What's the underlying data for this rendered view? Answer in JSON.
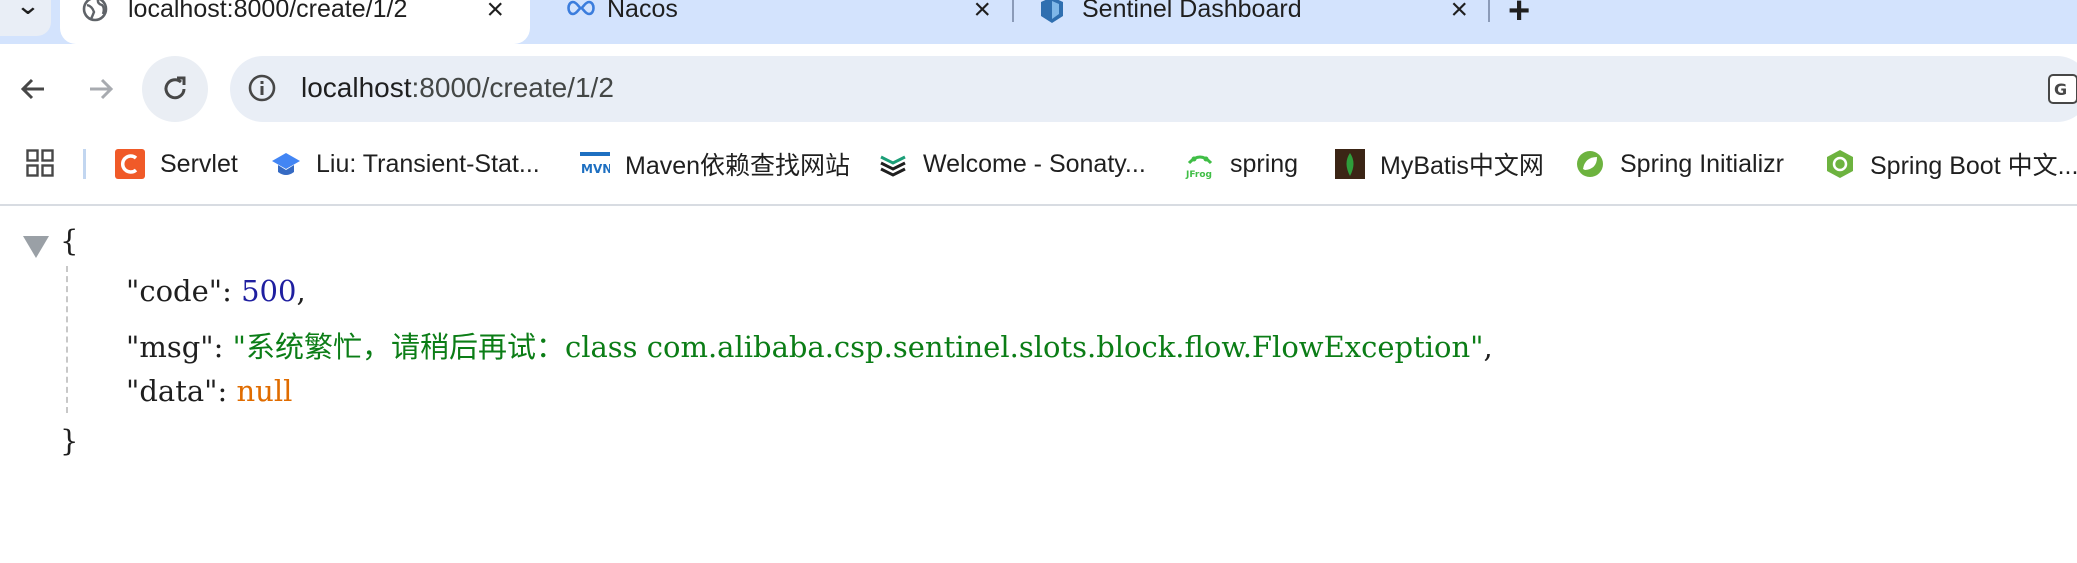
{
  "tabs": [
    {
      "title": "localhost:8000/create/1/2",
      "icon": "globe-icon",
      "active": true
    },
    {
      "title": "Nacos",
      "icon": "nacos-logo-icon",
      "active": false
    },
    {
      "title": "Sentinel Dashboard",
      "icon": "sentinel-logo-icon",
      "active": false
    }
  ],
  "address_bar": {
    "host": "localhost",
    "path": ":8000/create/1/2"
  },
  "bookmarks": [
    {
      "label": "Servlet",
      "icon": "servlet-icon"
    },
    {
      "label": "Liu: Transient-Stat...",
      "icon": "graduation-cap-icon"
    },
    {
      "label": "Maven依赖查找网站",
      "icon": "mvn-icon"
    },
    {
      "label": "Welcome - Sonaty...",
      "icon": "sonatype-icon"
    },
    {
      "label": "spring",
      "icon": "jfrog-icon"
    },
    {
      "label": "MyBatis中文网",
      "icon": "mybatis-icon"
    },
    {
      "label": "Spring Initializr",
      "icon": "spring-icon"
    },
    {
      "label": "Spring Boot 中文...",
      "icon": "spring-boot-icon"
    }
  ],
  "json_view": {
    "open_brace": "{",
    "close_brace": "}",
    "fields": [
      {
        "key": "\"code\"",
        "sep": ": ",
        "value": "500",
        "trail": ",",
        "type": "number"
      },
      {
        "key": "\"msg\"",
        "sep": ": ",
        "value": "\"系统繁忙，请稍后再试：class com.alibaba.csp.sentinel.slots.block.flow.FlowException\"",
        "trail": ",",
        "type": "string"
      },
      {
        "key": "\"data\"",
        "sep": ": ",
        "value": "null",
        "trail": "",
        "type": "null"
      }
    ]
  },
  "colors": {
    "tabstrip": "#d3e3fd",
    "omnibox": "#e9eef6",
    "json_number": "#1f1fa0",
    "json_string": "#0b7d16",
    "json_null": "#e06c00"
  }
}
